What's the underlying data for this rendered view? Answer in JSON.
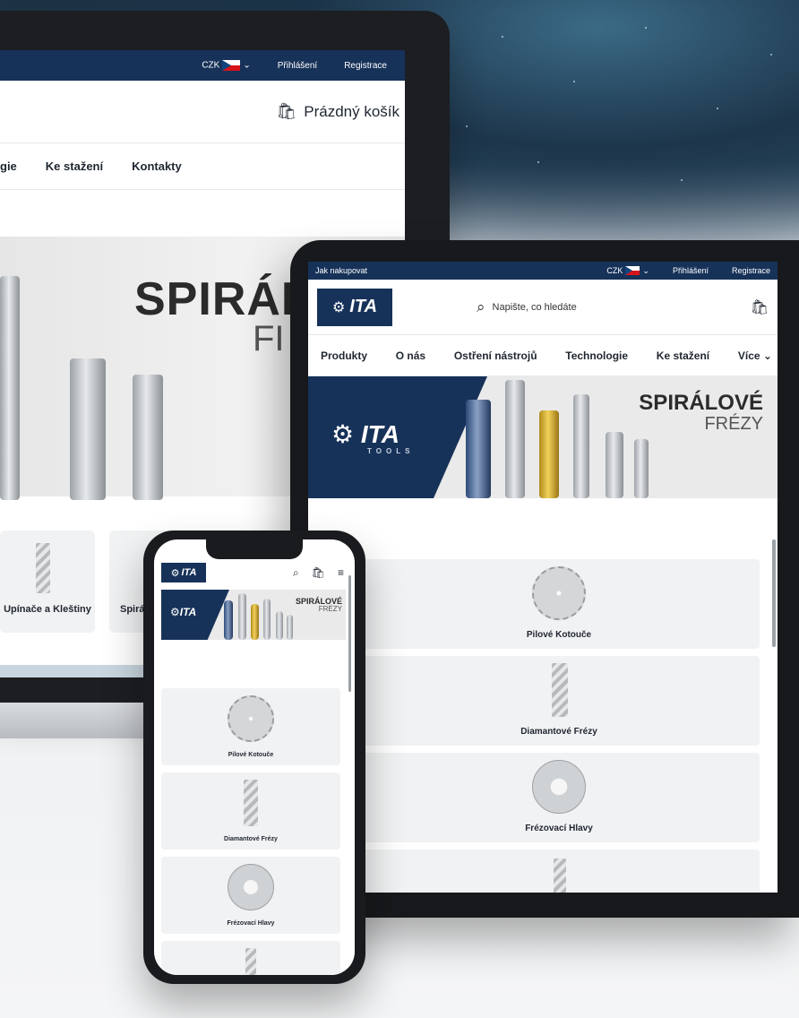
{
  "colors": {
    "navy": "#173259",
    "card_bg": "#f1f2f3",
    "text_dark": "#1f2630"
  },
  "laptop": {
    "topbar": {
      "currency": "CZK",
      "login": "Přihlášení",
      "register": "Registrace"
    },
    "cart_label": "Prázdný košík",
    "nav": [
      "gie",
      "Ke stažení",
      "Kontakty"
    ],
    "hero": {
      "title": "SPIRÁLOVÉ",
      "subtitle": "FI"
    },
    "categories": [
      "Upínače a Kleštiny",
      "Spirá"
    ]
  },
  "tablet": {
    "topbar": {
      "how_to_shop": "Jak nakupovat",
      "currency": "CZK",
      "login": "Přihlášení",
      "register": "Registrace"
    },
    "logo": "ITA",
    "logo_sub": "TOOLS",
    "search_placeholder": "Napište, co hledáte",
    "nav": [
      "Produkty",
      "O nás",
      "Ostření nástrojů",
      "Technologie",
      "Ke stažení",
      "Více"
    ],
    "hero": {
      "logo": "ITA",
      "logo_sub": "TOOLS",
      "title": "SPIRÁLOVÉ",
      "subtitle": "FRÉZY"
    },
    "categories": [
      "Pilové Kotouče",
      "Diamantové Frézy",
      "Frézovací Hlavy"
    ]
  },
  "phone": {
    "logo": "ITA",
    "hero": {
      "logo": "ITA",
      "title": "SPIRÁLOVÉ",
      "subtitle": "FRÉZY"
    },
    "categories": [
      "Pilové Kotouče",
      "Diamantové Frézy",
      "Frézovací Hlavy"
    ]
  }
}
